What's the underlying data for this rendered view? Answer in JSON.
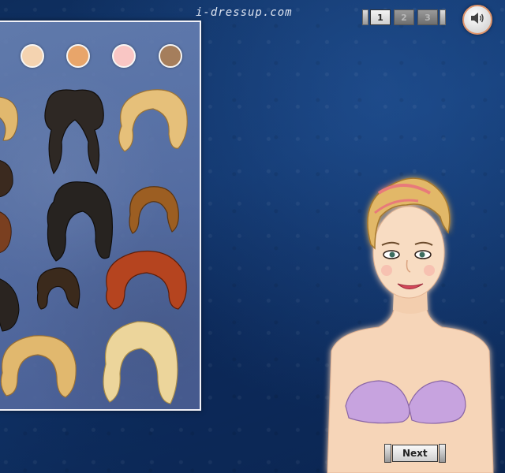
{
  "header": {
    "logo_text": "i-dressup.com",
    "pages": [
      "1",
      "2",
      "3"
    ],
    "active_page": "1"
  },
  "panel": {
    "skin_swatches": [
      {
        "name": "fair",
        "color": "#f4d3b0"
      },
      {
        "name": "tan",
        "color": "#e8a56a"
      },
      {
        "name": "pink",
        "color": "#f9c6c4"
      },
      {
        "name": "brown",
        "color": "#a57e5c"
      }
    ],
    "hair_colors": {
      "blonde": "#e6c07a",
      "dark": "#2e2824",
      "auburn": "#a85a2e",
      "ginger": "#b5441f",
      "platinum": "#ecd59b"
    }
  },
  "footer": {
    "next_label": "Next"
  },
  "icons": [
    "speaker-icon"
  ]
}
